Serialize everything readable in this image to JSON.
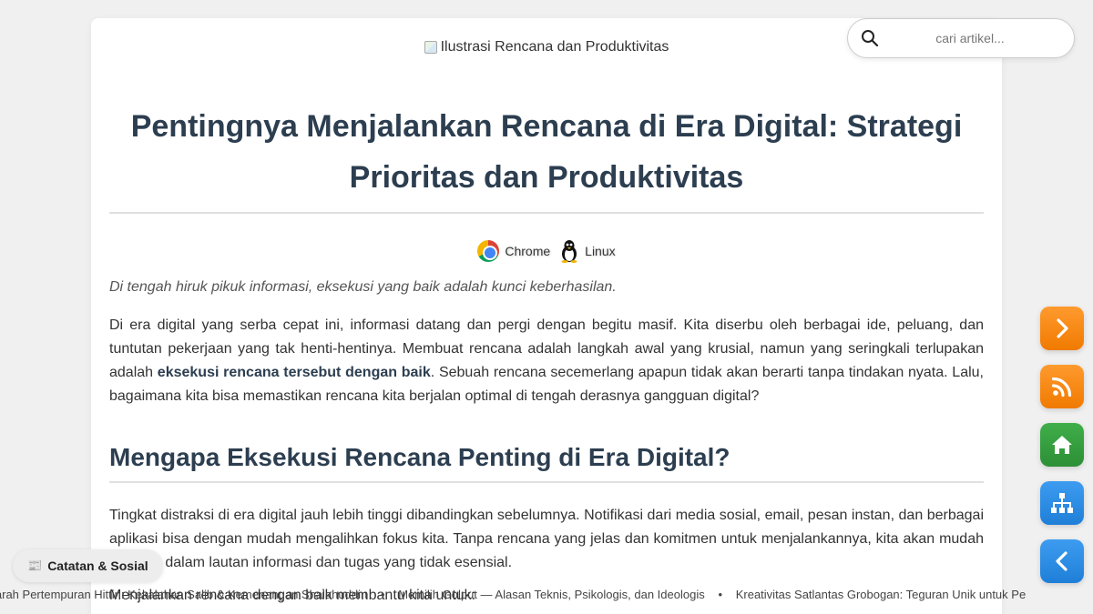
{
  "article": {
    "hero_alt": "Ilustrasi Rencana dan Produktivitas",
    "title": "Pentingnya Menjalankan Rencana di Era Digital: Strategi Prioritas dan Produktivitas",
    "platforms": [
      {
        "label": "Chrome",
        "icon": "chrome-icon"
      },
      {
        "label": "Linux",
        "icon": "linux-tux-icon"
      }
    ],
    "tagline": "Di tengah hiruk pikuk informasi, eksekusi yang baik adalah kunci keberhasilan.",
    "paragraph1": {
      "before": "Di era digital yang serba cepat ini, informasi datang dan pergi dengan begitu masif. Kita diserbu oleh berbagai ide, peluang, dan tuntutan pekerjaan yang tak henti-hentinya. Membuat rencana adalah langkah awal yang krusial, namun yang seringkali terlupakan adalah ",
      "bold": "eksekusi rencana tersebut dengan baik",
      "after": ". Sebuah rencana secemerlang apapun tidak akan berarti tanpa tindakan nyata. Lalu, bagaimana kita bisa memastikan rencana kita berjalan optimal di tengah derasnya gangguan digital?"
    },
    "section_heading": "Mengapa Eksekusi Rencana Penting di Era Digital?",
    "paragraph2": "Tingkat distraksi di era digital jauh lebih tinggi dibandingkan sebelumnya. Notifikasi dari media sosial, email, pesan instan, dan berbagai aplikasi bisa dengan mudah mengalihkan fokus kita. Tanpa rencana yang jelas dan komitmen untuk menjalankannya, kita akan mudah tersesat dalam lautan informasi dan tugas yang tidak esensial.",
    "paragraph3": "Menjalankan rencana dengan baik membantu kita untuk:"
  },
  "search": {
    "placeholder": "cari artikel...",
    "icon": "search-icon"
  },
  "fabs": [
    {
      "name": "next-button",
      "icon": "chevron-right-icon",
      "color": "#f7860e"
    },
    {
      "name": "rss-button",
      "icon": "rss-icon",
      "color": "#f7860e"
    },
    {
      "name": "home-button",
      "icon": "home-icon",
      "color": "#36a040"
    },
    {
      "name": "sitemap-button",
      "icon": "sitemap-icon",
      "color": "#2a8ce4"
    },
    {
      "name": "back-button",
      "icon": "chevron-left-icon",
      "color": "#2a8ce4"
    }
  ],
  "notes_chip": {
    "icon": "📰",
    "label": "Catatan & Sosial"
  },
  "ticker": {
    "bullet": "•",
    "items": [
      "jarah Pertempuran Hittin: Kekalahan Salib & Kemenangan Shalahuddin",
      "Memilih Golput — Alasan Teknis, Psikologis, dan Ideologis",
      "Kreativitas Satlantas Grobogan: Teguran Unik untuk Pe"
    ]
  }
}
